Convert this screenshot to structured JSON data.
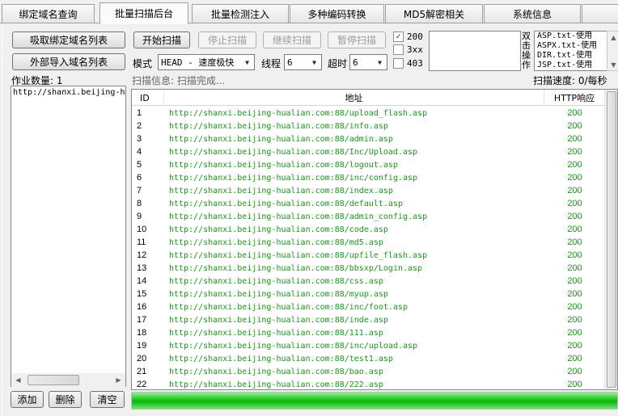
{
  "tabs": [
    "绑定域名查询",
    "批量扫描后台",
    "批量检测注入",
    "多种编码转换",
    "MD5解密相关",
    "系统信息"
  ],
  "active_tab": "批量扫描后台",
  "left": {
    "btn_fetch": "吸取绑定域名列表",
    "btn_import": "外部导入域名列表",
    "task_count": "作业数量: 1",
    "domains": [
      "http://shanxi.beijing-h"
    ],
    "btn_add": "添加",
    "btn_delete": "删除",
    "btn_clear": "清空"
  },
  "controls": {
    "btn_start": "开始扫描",
    "btn_stop": "停止扫描",
    "btn_continue": "继续扫描",
    "btn_pause": "暂停扫描",
    "mode_label": "模式",
    "mode_value": "HEAD - 速度极快",
    "threads_label": "线程",
    "threads_value": "6",
    "timeout_label": "超时",
    "timeout_value": "6",
    "status_200": "200",
    "status_3xx": "3xx",
    "status_403": "403",
    "dict_side_label": "双击操作",
    "dicts": [
      "ASP.txt-使用",
      "ASPX.txt-使用",
      "DIR.txt-使用",
      "JSP.txt-使用"
    ],
    "scan_info": "扫描信息: 扫描完成...",
    "scan_speed": "扫描速度: 0/每秒"
  },
  "table": {
    "headers": [
      "ID",
      "地址",
      "HTTP响应"
    ],
    "rows": [
      [
        "1",
        "http://shanxi.beijing-hualian.com:88/upload_flash.asp",
        "200"
      ],
      [
        "2",
        "http://shanxi.beijing-hualian.com:88/info.asp",
        "200"
      ],
      [
        "3",
        "http://shanxi.beijing-hualian.com:88/admin.asp",
        "200"
      ],
      [
        "4",
        "http://shanxi.beijing-hualian.com:88/Inc/Upload.asp",
        "200"
      ],
      [
        "5",
        "http://shanxi.beijing-hualian.com:88/logout.asp",
        "200"
      ],
      [
        "6",
        "http://shanxi.beijing-hualian.com:88/inc/config.asp",
        "200"
      ],
      [
        "7",
        "http://shanxi.beijing-hualian.com:88/index.asp",
        "200"
      ],
      [
        "8",
        "http://shanxi.beijing-hualian.com:88/default.asp",
        "200"
      ],
      [
        "9",
        "http://shanxi.beijing-hualian.com:88/admin_config.asp",
        "200"
      ],
      [
        "10",
        "http://shanxi.beijing-hualian.com:88/code.asp",
        "200"
      ],
      [
        "11",
        "http://shanxi.beijing-hualian.com:88/md5.asp",
        "200"
      ],
      [
        "12",
        "http://shanxi.beijing-hualian.com:88/upfile_flash.asp",
        "200"
      ],
      [
        "13",
        "http://shanxi.beijing-hualian.com:88/bbsxp/Login.asp",
        "200"
      ],
      [
        "14",
        "http://shanxi.beijing-hualian.com:88/css.asp",
        "200"
      ],
      [
        "15",
        "http://shanxi.beijing-hualian.com:88/myup.asp",
        "200"
      ],
      [
        "16",
        "http://shanxi.beijing-hualian.com:88/inc/foot.asp",
        "200"
      ],
      [
        "17",
        "http://shanxi.beijing-hualian.com:88/inde.asp",
        "200"
      ],
      [
        "18",
        "http://shanxi.beijing-hualian.com:88/111.asp",
        "200"
      ],
      [
        "19",
        "http://shanxi.beijing-hualian.com:88/inc/upload.asp",
        "200"
      ],
      [
        "20",
        "http://shanxi.beijing-hualian.com:88/test1.asp",
        "200"
      ],
      [
        "21",
        "http://shanxi.beijing-hualian.com:88/bao.asp",
        "200"
      ],
      [
        "22",
        "http://shanxi.beijing-hualian.com:88/222.asp",
        "200"
      ]
    ]
  },
  "progress": 1.0,
  "colors": {
    "url_green": "#1a9a1a",
    "progress_green": "#16c316"
  }
}
